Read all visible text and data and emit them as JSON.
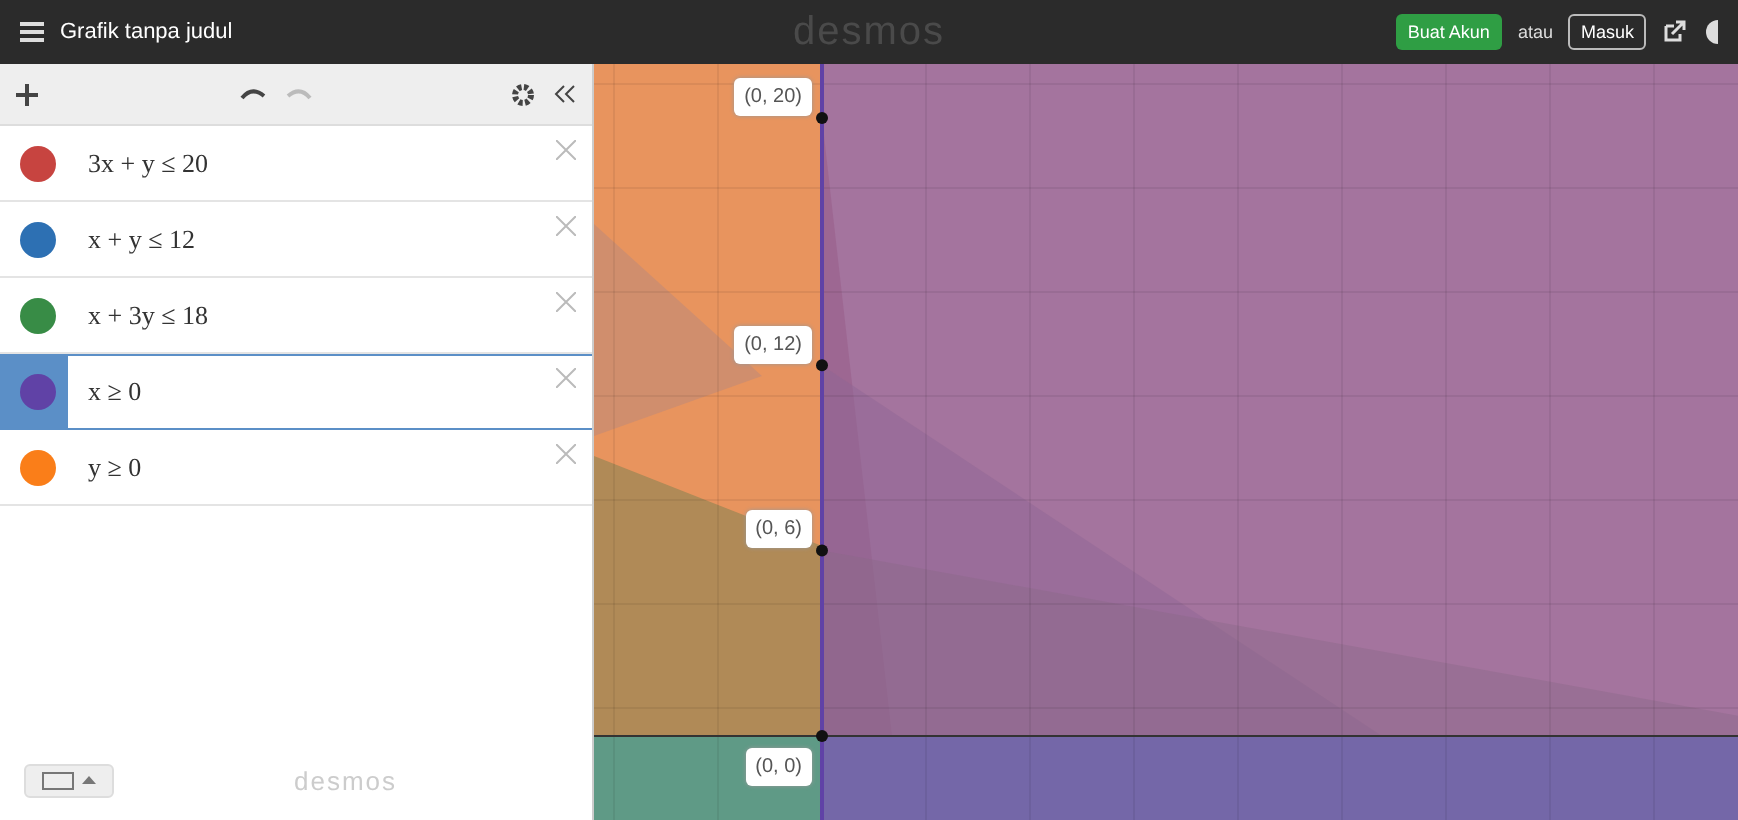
{
  "topbar": {
    "title": "Grafik tanpa judul",
    "logo": "desmos",
    "signup": "Buat Akun",
    "or": "atau",
    "login": "Masuk"
  },
  "expressions": [
    {
      "latex": "3x + y ≤ 20",
      "color": "#c74440",
      "selected": false
    },
    {
      "latex": "x + y ≤ 12",
      "color": "#2d70b3",
      "selected": false
    },
    {
      "latex": "x + 3y ≤ 18",
      "color": "#388c46",
      "selected": false
    },
    {
      "latex": "x ≥ 0",
      "color": "#6042a6",
      "selected": true
    },
    {
      "latex": "y ≥ 0",
      "color": "#fa7e19",
      "selected": false
    }
  ],
  "footer": {
    "logo": "desmos"
  },
  "graph": {
    "points": [
      {
        "label": "(0, 20)"
      },
      {
        "label": "(0, 12)"
      },
      {
        "label": "(0, 6)"
      },
      {
        "label": "(0, 0)"
      }
    ]
  }
}
